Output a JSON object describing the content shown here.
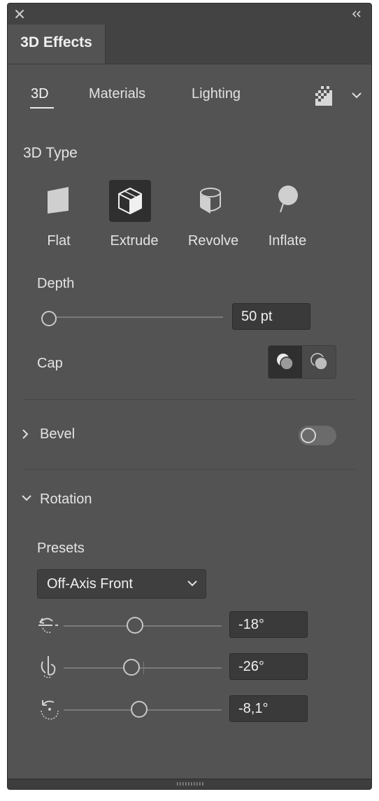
{
  "panel": {
    "title_tab": "3D Effects",
    "close_icon": "close-icon",
    "collapse_icon": "double-chevron-left-icon"
  },
  "subtabs": {
    "items": [
      "3D",
      "Materials",
      "Lighting"
    ],
    "active": "3D"
  },
  "type_section": {
    "title": "3D Type",
    "types": [
      "Flat",
      "Extrude",
      "Revolve",
      "Inflate"
    ],
    "selected": "Extrude"
  },
  "depth": {
    "label": "Depth",
    "value": "50 pt",
    "slider_fraction": 0.0
  },
  "cap": {
    "label": "Cap",
    "selected": "cap-on"
  },
  "bevel": {
    "label": "Bevel",
    "enabled": false
  },
  "rotation": {
    "label": "Rotation",
    "presets_label": "Presets",
    "preset_value": "Off-Axis Front",
    "x": {
      "value": "-18°",
      "slider_fraction": 0.45
    },
    "y": {
      "value": "-26°",
      "slider_fraction": 0.43
    },
    "z": {
      "value": "-8,1°",
      "slider_fraction": 0.48
    }
  },
  "colors": {
    "panel_bg": "#535353",
    "chrome_bg": "#434343",
    "field_bg": "#3a3a3a",
    "selected_bg": "#2f2f2f",
    "text": "#e6e6e6"
  }
}
